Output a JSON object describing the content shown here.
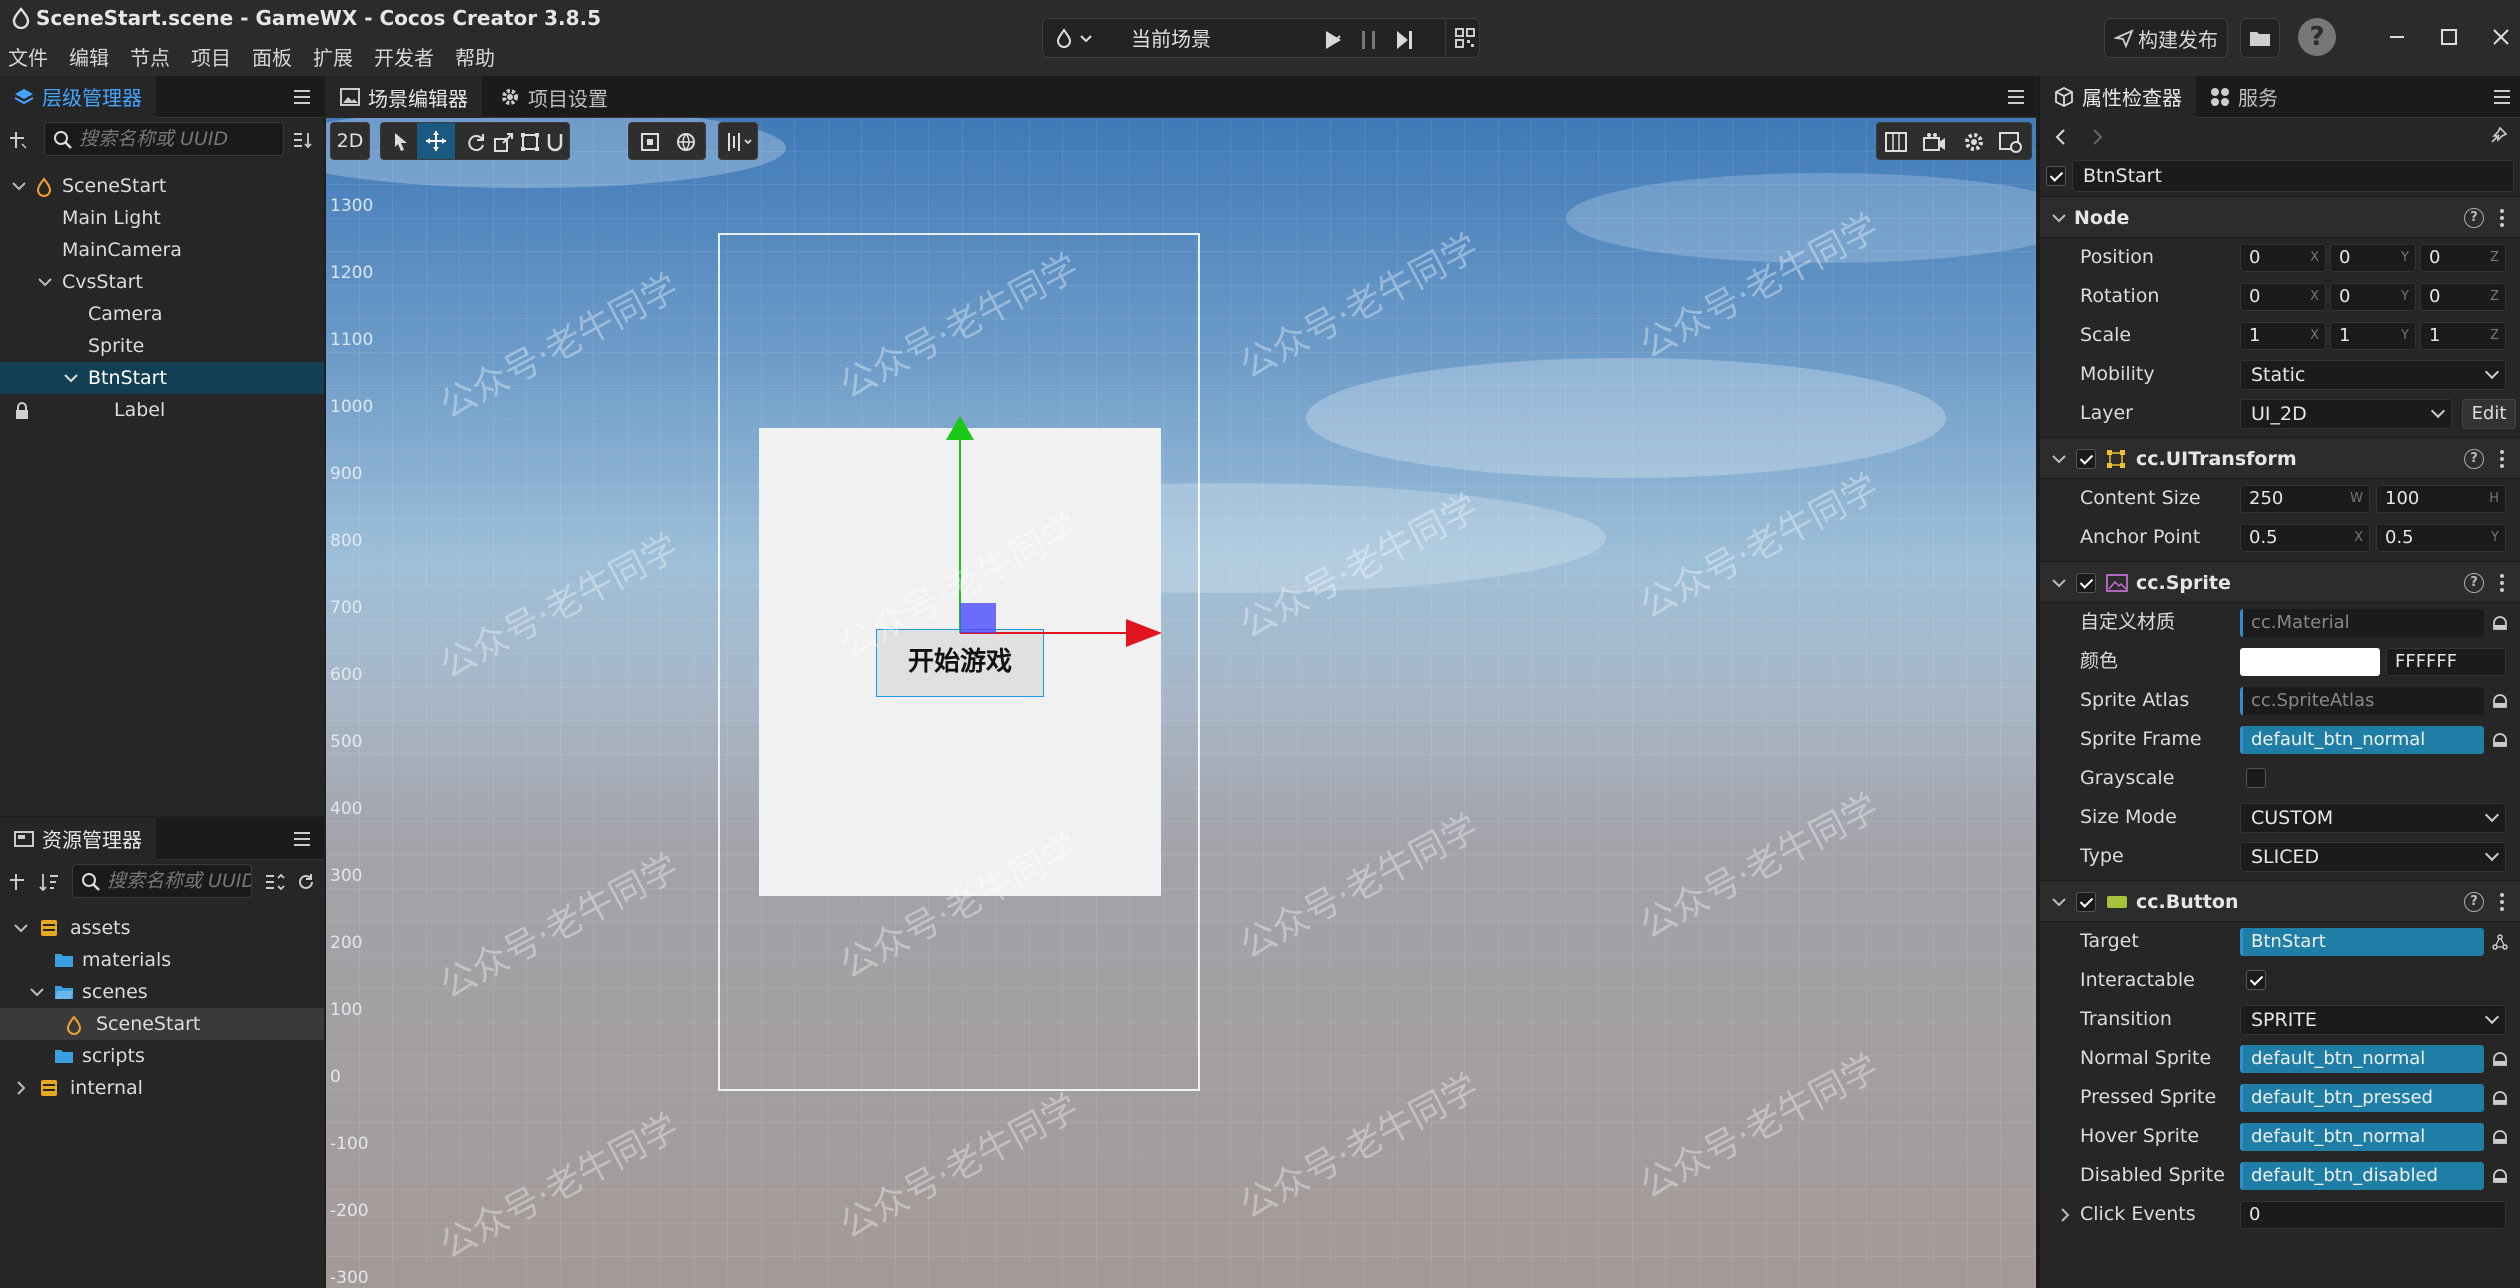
{
  "window": {
    "title": "SceneStart.scene - GameWX - Cocos Creator 3.8.5",
    "menu": [
      "文件",
      "编辑",
      "节点",
      "项目",
      "面板",
      "扩展",
      "开发者",
      "帮助"
    ],
    "scene_select": "当前场景",
    "build_label": "构建发布",
    "help_label": "?"
  },
  "hierarchy": {
    "tab": "层级管理器",
    "search_placeholder": "搜索名称或 UUID",
    "nodes": [
      {
        "label": "SceneStart"
      },
      {
        "label": "Main Light"
      },
      {
        "label": "MainCamera"
      },
      {
        "label": "CvsStart"
      },
      {
        "label": "Camera"
      },
      {
        "label": "Sprite"
      },
      {
        "label": "BtnStart"
      },
      {
        "label": "Label"
      }
    ]
  },
  "assets": {
    "tab": "资源管理器",
    "search_placeholder": "搜索名称或 UUID",
    "items": [
      {
        "label": "assets"
      },
      {
        "label": "materials"
      },
      {
        "label": "scenes"
      },
      {
        "label": "SceneStart"
      },
      {
        "label": "scripts"
      },
      {
        "label": "internal"
      }
    ]
  },
  "scene_editor": {
    "tabs": [
      "场景编辑器",
      "项目设置"
    ],
    "mode_2d": "2D",
    "y_ticks": [
      "1300",
      "1200",
      "1100",
      "1000",
      "900",
      "800",
      "700",
      "600",
      "500",
      "400",
      "300",
      "200",
      "100",
      "0",
      "-100",
      "-200",
      "-300"
    ],
    "button_label": "开始游戏",
    "watermark": "公众号·老牛同学"
  },
  "inspector": {
    "tabs": [
      "属性检查器",
      "服务"
    ],
    "node_name": "BtnStart",
    "node_section": {
      "title": "Node",
      "position": {
        "label": "Position",
        "x": "0",
        "y": "0",
        "z": "0"
      },
      "rotation": {
        "label": "Rotation",
        "x": "0",
        "y": "0",
        "z": "0"
      },
      "scale": {
        "label": "Scale",
        "x": "1",
        "y": "1",
        "z": "1"
      },
      "mobility": {
        "label": "Mobility",
        "value": "Static"
      },
      "layer": {
        "label": "Layer",
        "value": "UI_2D",
        "edit": "Edit"
      }
    },
    "axis": {
      "x": "X",
      "y": "Y",
      "z": "Z",
      "w": "W",
      "h": "H"
    },
    "uitransform": {
      "title": "cc.UITransform",
      "content_size": {
        "label": "Content Size",
        "w": "250",
        "h": "100"
      },
      "anchor_point": {
        "label": "Anchor Point",
        "x": "0.5",
        "y": "0.5"
      }
    },
    "sprite": {
      "title": "cc.Sprite",
      "custom_material": {
        "label": "自定义材质",
        "value": "cc.Material"
      },
      "color": {
        "label": "颜色",
        "value": "FFFFFF",
        "swatch": "#ffffff"
      },
      "sprite_atlas": {
        "label": "Sprite Atlas",
        "value": "cc.SpriteAtlas"
      },
      "sprite_frame": {
        "label": "Sprite Frame",
        "value": "default_btn_normal"
      },
      "grayscale": {
        "label": "Grayscale",
        "checked": false
      },
      "size_mode": {
        "label": "Size Mode",
        "value": "CUSTOM"
      },
      "type": {
        "label": "Type",
        "value": "SLICED"
      }
    },
    "button": {
      "title": "cc.Button",
      "target": {
        "label": "Target",
        "value": "BtnStart"
      },
      "interactable": {
        "label": "Interactable",
        "checked": true
      },
      "transition": {
        "label": "Transition",
        "value": "SPRITE"
      },
      "normal_sprite": {
        "label": "Normal Sprite",
        "value": "default_btn_normal"
      },
      "pressed_sprite": {
        "label": "Pressed Sprite",
        "value": "default_btn_pressed"
      },
      "hover_sprite": {
        "label": "Hover Sprite",
        "value": "default_btn_normal"
      },
      "disabled_sprite": {
        "label": "Disabled Sprite",
        "value": "default_btn_disabled"
      },
      "click_events": {
        "label": "Click Events",
        "value": "0"
      }
    }
  },
  "colors": {
    "accent": "#45a4ff",
    "selection": "#133f54",
    "asset_field": "#1f7ea6",
    "gizmo_x": "#e0151d",
    "gizmo_y": "#18c918",
    "gizmo_center": "#4b4bff"
  }
}
